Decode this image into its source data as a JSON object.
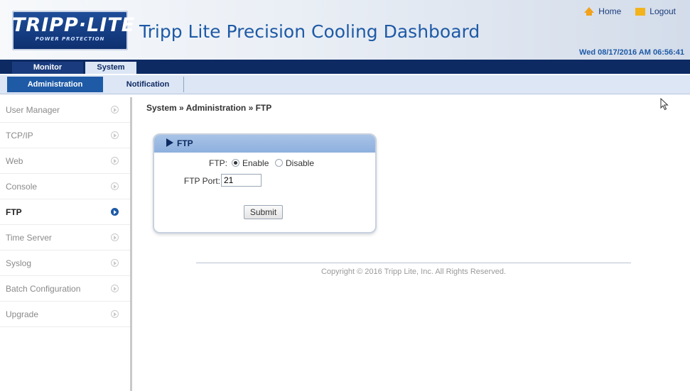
{
  "header": {
    "logo_text": "TRIPP·LITE",
    "logo_subtext": "POWER PROTECTION",
    "title": "Tripp Lite Precision Cooling Dashboard",
    "links": {
      "home": "Home",
      "logout": "Logout"
    },
    "datetime": "Wed 08/17/2016 AM 06:56:41"
  },
  "nav": {
    "primary_tabs": [
      "Monitor",
      "System"
    ],
    "primary_active": "System",
    "secondary_tabs": [
      "Administration",
      "Notification"
    ],
    "secondary_active": "Administration"
  },
  "sidebar": {
    "items": [
      {
        "label": "User Manager"
      },
      {
        "label": "TCP/IP"
      },
      {
        "label": "Web"
      },
      {
        "label": "Console"
      },
      {
        "label": "FTP"
      },
      {
        "label": "Time Server"
      },
      {
        "label": "Syslog"
      },
      {
        "label": "Batch Configuration"
      },
      {
        "label": "Upgrade"
      }
    ],
    "active": "FTP"
  },
  "main": {
    "breadcrumb": "System » Administration » FTP",
    "panel": {
      "title": "FTP",
      "ftp_label": "FTP:",
      "enable_label": "Enable",
      "disable_label": "Disable",
      "selected": "Enable",
      "port_label": "FTP Port:",
      "port_value": "21",
      "submit_label": "Submit"
    },
    "copyright": "Copyright © 2016 Tripp Lite, Inc. All Rights Reserved."
  },
  "colors": {
    "navy": "#0d2a63",
    "accent_blue": "#1e5aa6",
    "panel_header": "#a8c3e6",
    "home_icon": "#f2a21c",
    "logout_icon": "#f2b31c"
  }
}
